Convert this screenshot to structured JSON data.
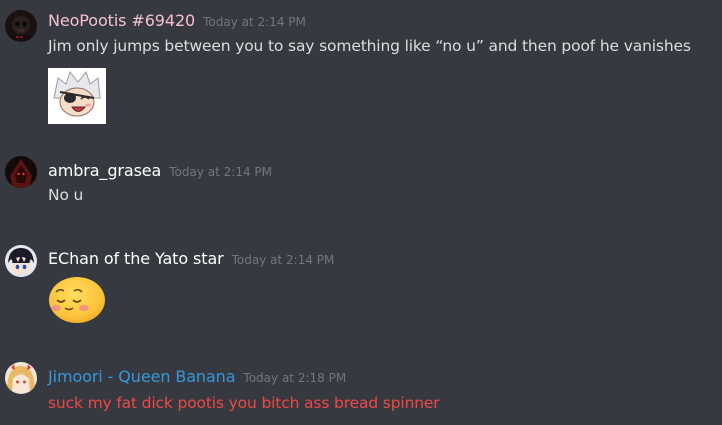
{
  "colors": {
    "background": "#36393f",
    "text": "#dcddde",
    "timestamp": "#72767d",
    "neopootis": "#f5c1cf",
    "ambra": "#ffffff",
    "echan": "#ffffff",
    "jimoori": "#3498db",
    "jimoori_message": "#f04747"
  },
  "messages": [
    {
      "username": "NeoPootis #69420",
      "timestamp": "Today at 2:14 PM",
      "text": "Jim only jumps between you to say something like “no u” and then poof he vanishes",
      "avatar_icon": "dark-skull-avatar-icon",
      "attachment": "anime-pirate-sticker"
    },
    {
      "username": "ambra_grasea",
      "timestamp": "Today at 2:14 PM",
      "text": "No u",
      "avatar_icon": "red-hooded-avatar-icon"
    },
    {
      "username": "EChan of the Yato star",
      "timestamp": "Today at 2:14 PM",
      "text": "",
      "avatar_icon": "anime-boy-avatar-icon",
      "attachment": "blushing-emoji"
    },
    {
      "username": "Jimoori - Queen Banana",
      "timestamp": "Today at 2:18 PM",
      "text": "suck my fat dick pootis you bitch ass bread spinner",
      "avatar_icon": "anime-girl-avatar-icon"
    }
  ]
}
